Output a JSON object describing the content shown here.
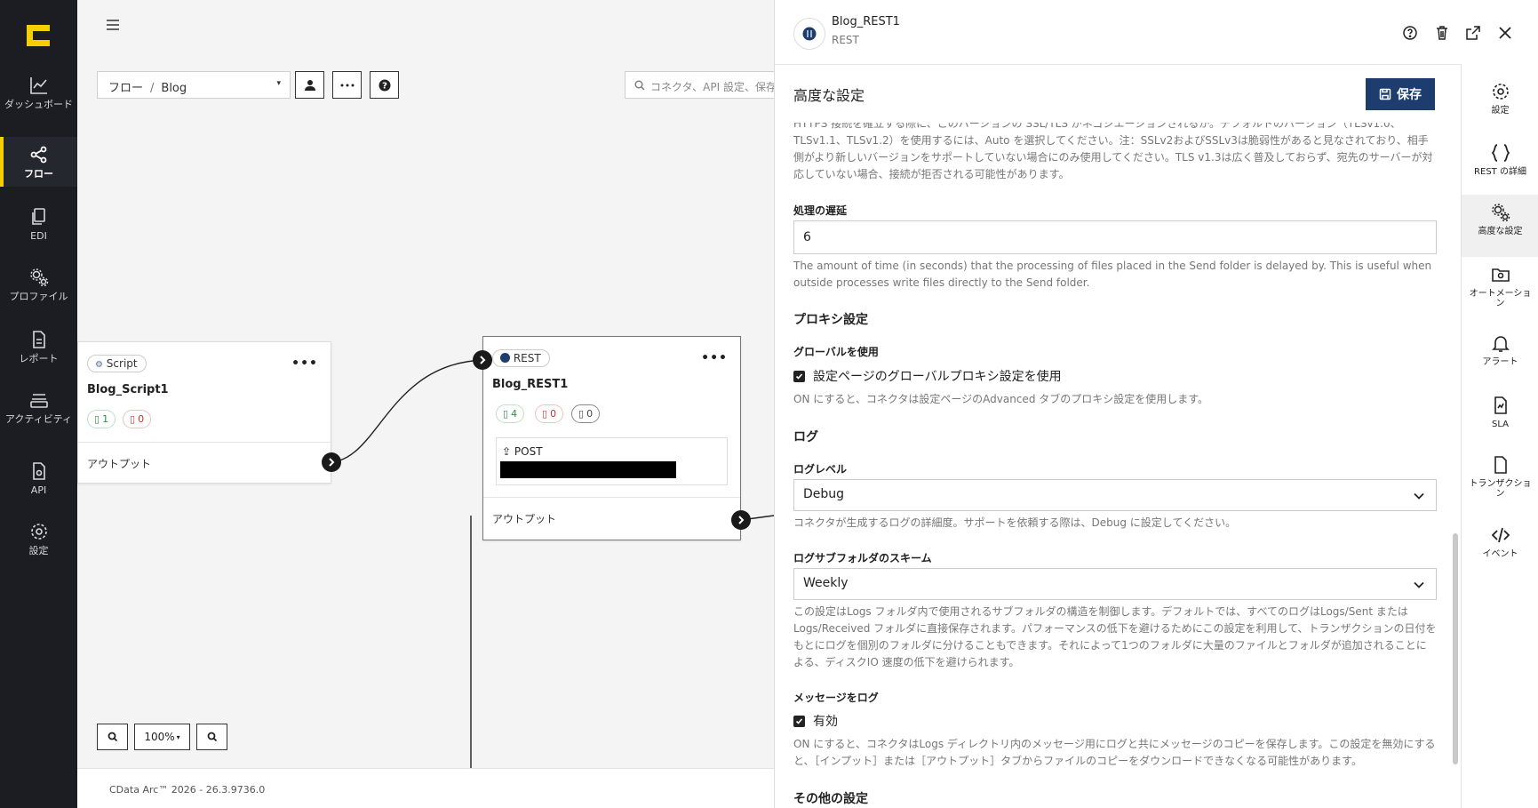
{
  "left_nav": {
    "items": [
      {
        "label": "ダッシュボード",
        "icon": "chart-line-icon"
      },
      {
        "label": "フロー",
        "icon": "flow-share-icon",
        "active": true
      },
      {
        "label": "EDI",
        "icon": "documents-icon"
      },
      {
        "label": "プロファイル",
        "icon": "gears-icon"
      },
      {
        "label": "レポート",
        "icon": "report-doc-icon"
      },
      {
        "label": "アクティビティ",
        "icon": "stack-icon"
      },
      {
        "label": "API",
        "icon": "api-doc-icon"
      },
      {
        "label": "設定",
        "icon": "gear-icon"
      }
    ]
  },
  "canvas": {
    "breadcrumb": {
      "root": "フロー",
      "current": "Blog"
    },
    "search_placeholder": "コネクタ、API 設定、保存",
    "nodes": [
      {
        "type": "Script",
        "name": "Blog_Script1",
        "counts": {
          "success": "1",
          "error": "0"
        },
        "output_label": "アウトプット"
      },
      {
        "type": "REST",
        "name": "Blog_REST1",
        "counts": {
          "success": "4",
          "error": "0",
          "pending": "0"
        },
        "method": "POST",
        "output_label": "アウトプット"
      }
    ],
    "zoom": "100%",
    "footer": "CData Arc™ 2026 - 26.3.9736.0"
  },
  "panel": {
    "connector_name": "Blog_REST1",
    "connector_type": "REST",
    "section_title": "高度な設定",
    "save_label": "保存",
    "tls_desc": "HTTPS 接続を確立する際に、このバージョンの SSL/TLS がネゴシエーションされるか。デフォルトのバージョン（TLSv1.0、TLSv1.1、TLSv1.2）を使用するには、Auto を選択してください。注：SSLv2およびSSLv3は脆弱性があると見なされており、相手側がより新しいバージョンをサポートしていない場合にのみ使用してください。TLS v1.3は広く普及しておらず、宛先のサーバーが対応していない場合、接続が拒否される可能性があります。",
    "processing_delay_label": "処理の遅延",
    "processing_delay_value": "6",
    "processing_delay_desc": "The amount of time (in seconds) that the processing of files placed in the Send folder is delayed by. This is useful when outside processes write files directly to the Send folder.",
    "proxy_heading": "プロキシ設定",
    "global_label": "グローバルを使用",
    "global_checkbox": "設定ページのグローバルプロキシ設定を使用",
    "global_desc": "ON にすると、コネクタは設定ページのAdvanced タブのプロキシ設定を使用します。",
    "log_heading": "ログ",
    "log_level_label": "ログレベル",
    "log_level_value": "Debug",
    "log_level_desc": "コネクタが生成するログの詳細度。サポートを依頼する際は、Debug に設定してください。",
    "log_scheme_label": "ログサブフォルダのスキーム",
    "log_scheme_value": "Weekly",
    "log_scheme_desc": "この設定はLogs フォルダ内で使用されるサブフォルダの構造を制御します。デフォルトでは、すべてのログはLogs/Sent またはLogs/Received フォルダに直接保存されます。パフォーマンスの低下を避けるためにこの設定を利用して、トランザクションの日付をもとにログを個別のフォルダに分けることもできます。それによって1つのフォルダに大量のファイルとフォルダが追加されることによる、ディスクIO 速度の低下を避けられます。",
    "log_messages_label": "メッセージをログ",
    "log_messages_checkbox": "有効",
    "log_messages_desc": "ON にすると、コネクタはLogs ディレクトリ内のメッセージ用にログと共にメッセージのコピーを保存します。この設定を無効にすると、［インプット］または［アウトプット］タブからファイルのコピーをダウンロードできなくなる可能性があります。",
    "other_heading": "その他の設定"
  },
  "rail": {
    "items": [
      {
        "label": "設定",
        "icon": "gear-icon"
      },
      {
        "label": "REST の詳細",
        "icon": "braces-icon"
      },
      {
        "label": "高度な設定",
        "icon": "gears-icon",
        "active": true
      },
      {
        "label": "オートメーション",
        "icon": "folder-gear-icon"
      },
      {
        "label": "アラート",
        "icon": "bell-icon"
      },
      {
        "label": "SLA",
        "icon": "sla-doc-icon"
      },
      {
        "label": "トランザクション",
        "icon": "transaction-doc-icon"
      },
      {
        "label": "イベント",
        "icon": "code-icon"
      }
    ]
  }
}
